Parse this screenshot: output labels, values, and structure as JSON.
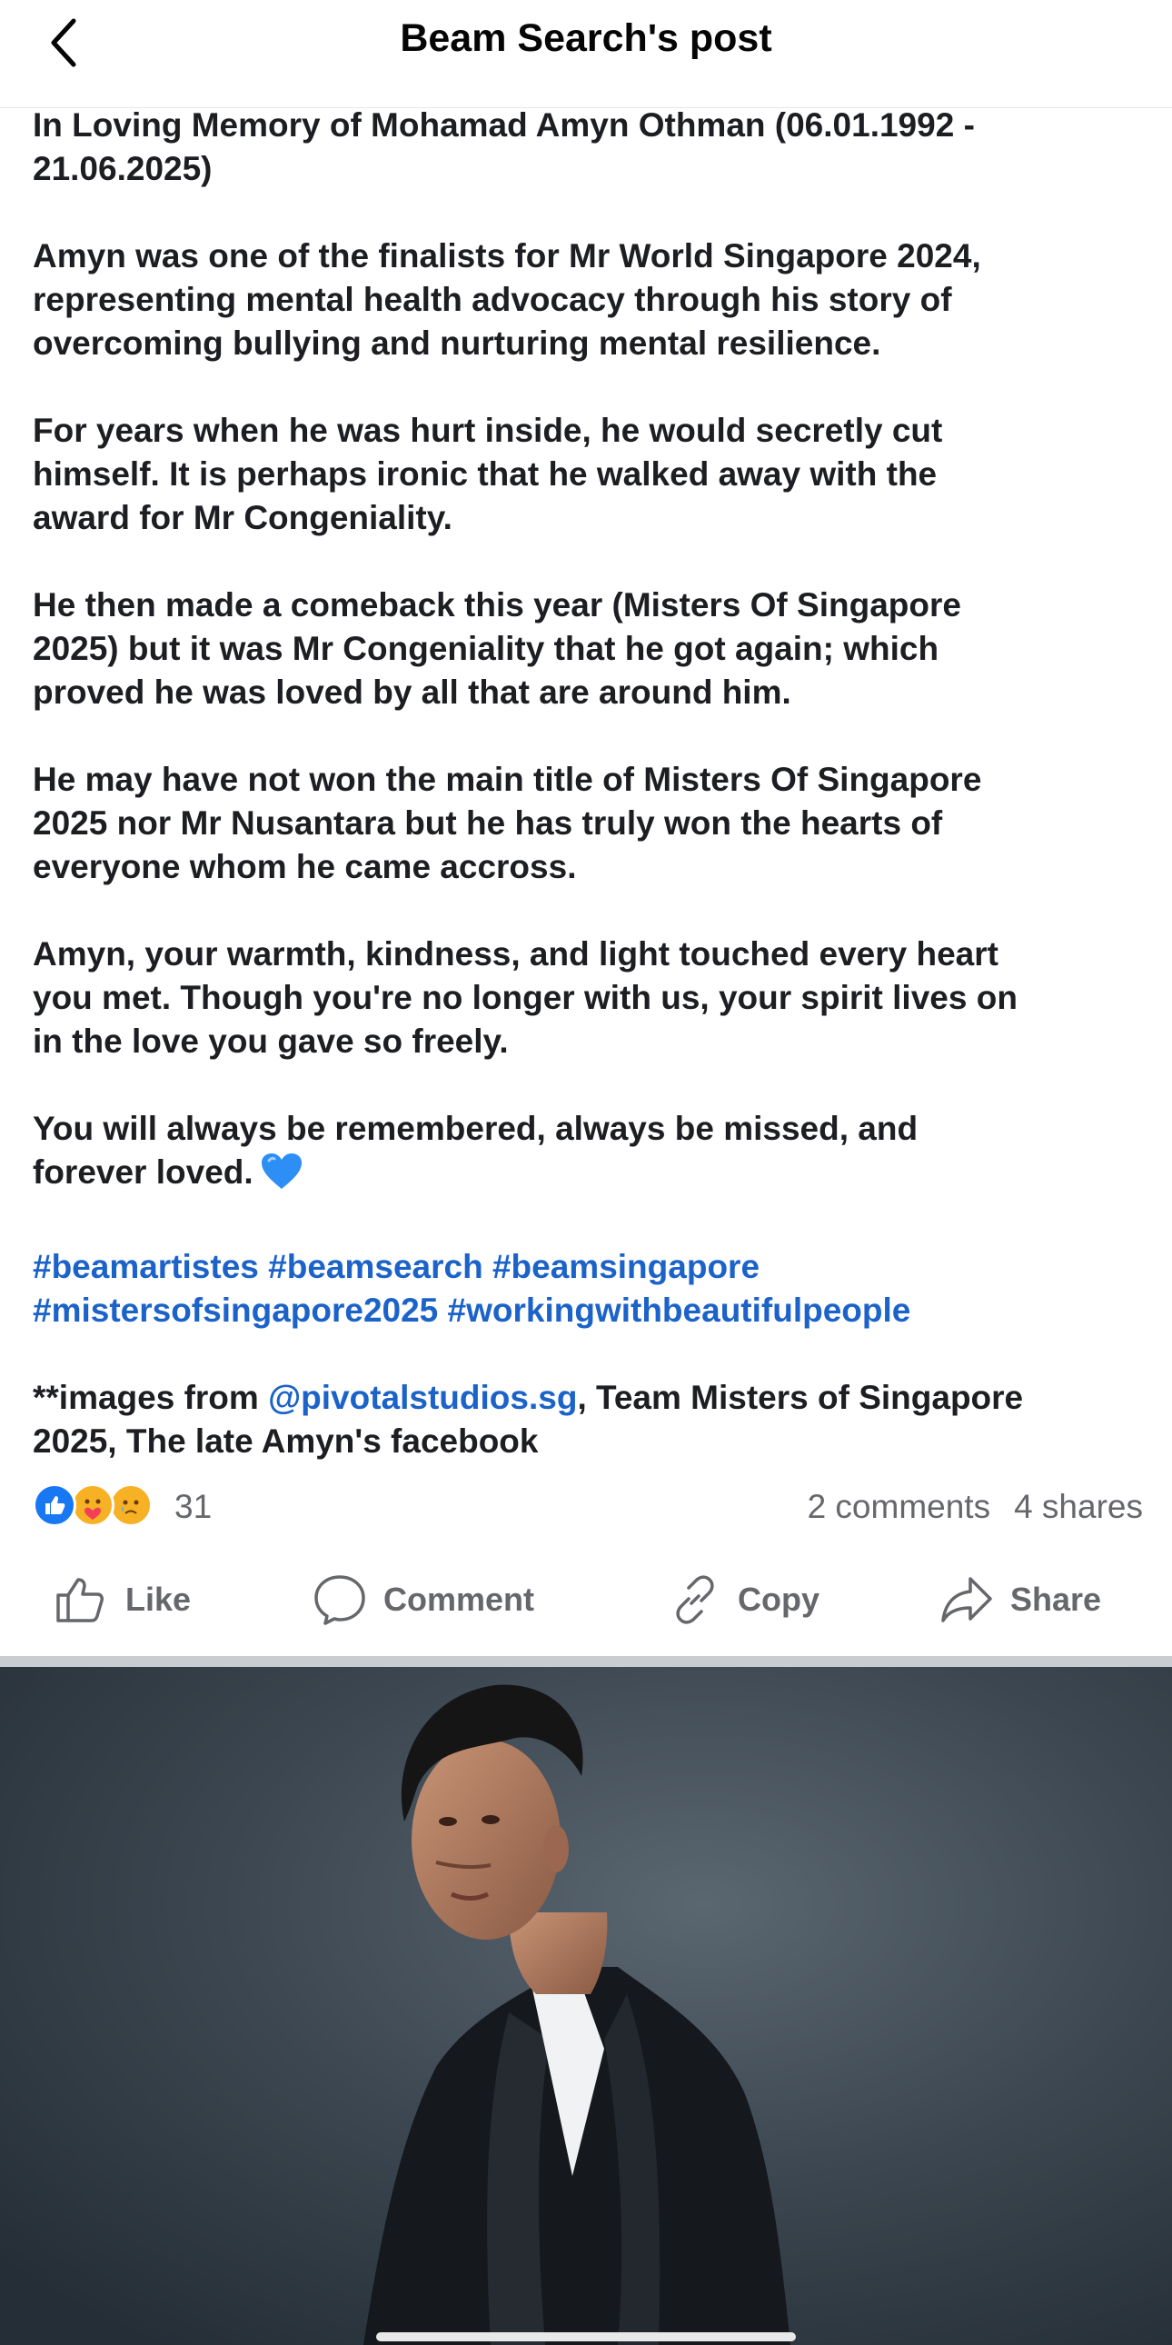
{
  "header": {
    "title": "Beam Search's post"
  },
  "post": {
    "paragraphs": [
      "In Loving Memory of Mohamad Amyn Othman (06.01.1992 -\n21.06.2025)",
      "Amyn was one of the finalists for Mr World Singapore 2024,\nrepresenting mental health advocacy through his story of\novercoming bullying and nurturing mental resilience.",
      "For years when he was hurt inside, he would secretly cut\nhimself. It is perhaps ironic that he walked away with the\naward for Mr Congeniality.",
      "He then made a comeback this year (Misters Of Singapore\n2025) but it was Mr Congeniality that he got again; which\nproved he was loved by all that are around him.",
      "He may have not won the main title of Misters Of Singapore\n2025 nor Mr Nusantara but he has  truly won the hearts of\neveryone whom he came accross.",
      "Amyn, your warmth, kindness, and light touched every heart\nyou met. Though you're no longer with us, your spirit lives on\nin the love you gave so freely."
    ],
    "closing": "You will always be remembered, always be missed, and\nforever loved.",
    "hashtags": "#beamartistes #beamsearch #beamsingapore\n#mistersofsingapore2025 #workingwithbeautifulpeople",
    "credits_prefix": "**images from ",
    "credits_mention": "@pivotalstudios.sg",
    "credits_suffix": ", Team Misters of Singapore\n2025, The late Amyn's facebook"
  },
  "reactions": {
    "icons": [
      "like-icon",
      "care-icon",
      "sad-icon"
    ],
    "count": "31",
    "comments": "2 comments",
    "shares": "4 shares"
  },
  "actions": {
    "like": "Like",
    "comment": "Comment",
    "copy": "Copy",
    "share": "Share"
  },
  "colors": {
    "text": "#1c1e21",
    "link": "#1b62c9",
    "secondary": "#65676b",
    "like_blue": "#1877f2",
    "heart_blue": "#2d8ef5"
  }
}
